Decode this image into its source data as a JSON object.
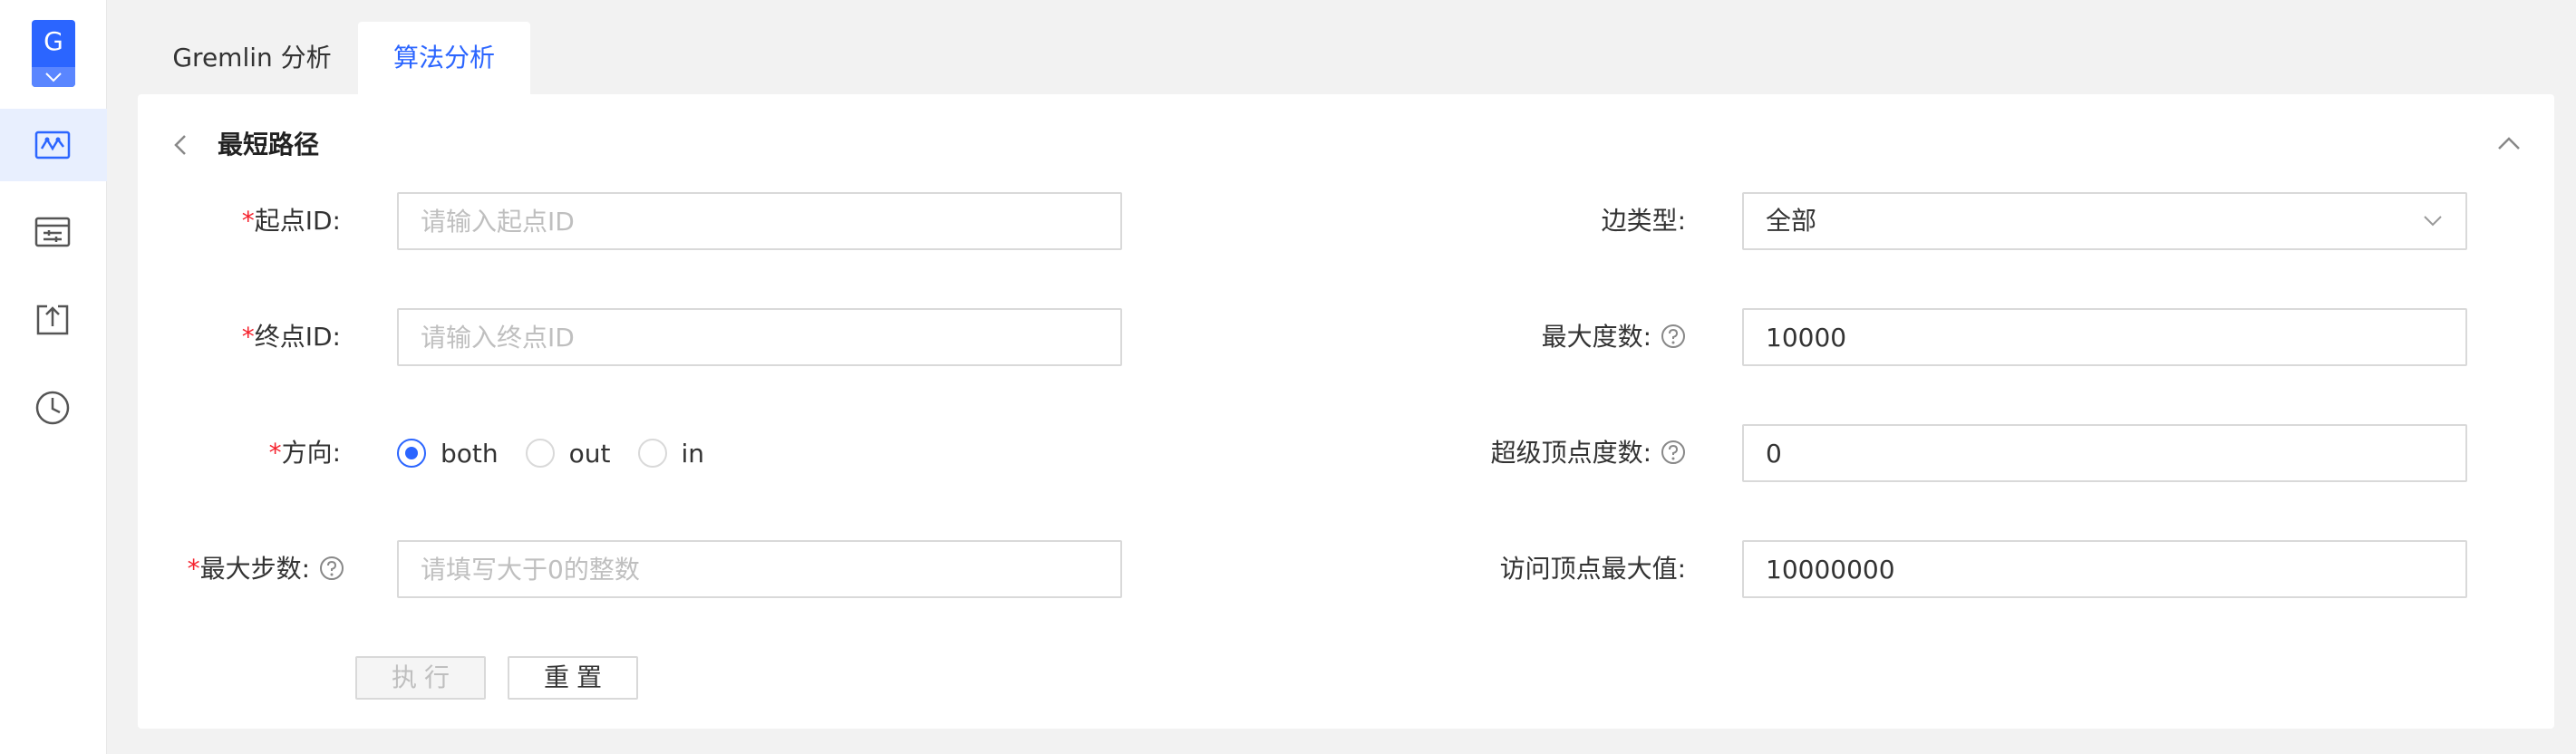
{
  "sidebar": {
    "logo_letter": "G",
    "items": [
      {
        "icon": "graph-analysis-icon",
        "active": true
      },
      {
        "icon": "data-table-icon",
        "active": false
      },
      {
        "icon": "import-upload-icon",
        "active": false
      },
      {
        "icon": "history-clock-icon",
        "active": false
      }
    ]
  },
  "tabs": [
    {
      "label": "Gremlin 分析",
      "active": false
    },
    {
      "label": "算法分析",
      "active": true
    }
  ],
  "panel": {
    "title": "最短路径",
    "fields": {
      "source_id": {
        "label": "起点ID:",
        "placeholder": "请输入起点ID",
        "required": true
      },
      "target_id": {
        "label": "终点ID:",
        "placeholder": "请输入终点ID",
        "required": true
      },
      "direction": {
        "label": "方向:",
        "required": true,
        "options": [
          "both",
          "out",
          "in"
        ],
        "selected": "both"
      },
      "max_steps": {
        "label": "最大步数:",
        "placeholder": "请填写大于0的整数",
        "required": true
      },
      "edge_type": {
        "label": "边类型:",
        "value": "全部"
      },
      "max_degree": {
        "label": "最大度数:",
        "value": "10000"
      },
      "super_vertex_degree": {
        "label": "超级顶点度数:",
        "value": "0"
      },
      "max_visited": {
        "label": "访问顶点最大值:",
        "value": "10000000"
      }
    },
    "buttons": {
      "execute": "执行",
      "reset": "重置"
    }
  },
  "colors": {
    "accent": "#2b65ff",
    "required": "#f5222d"
  }
}
